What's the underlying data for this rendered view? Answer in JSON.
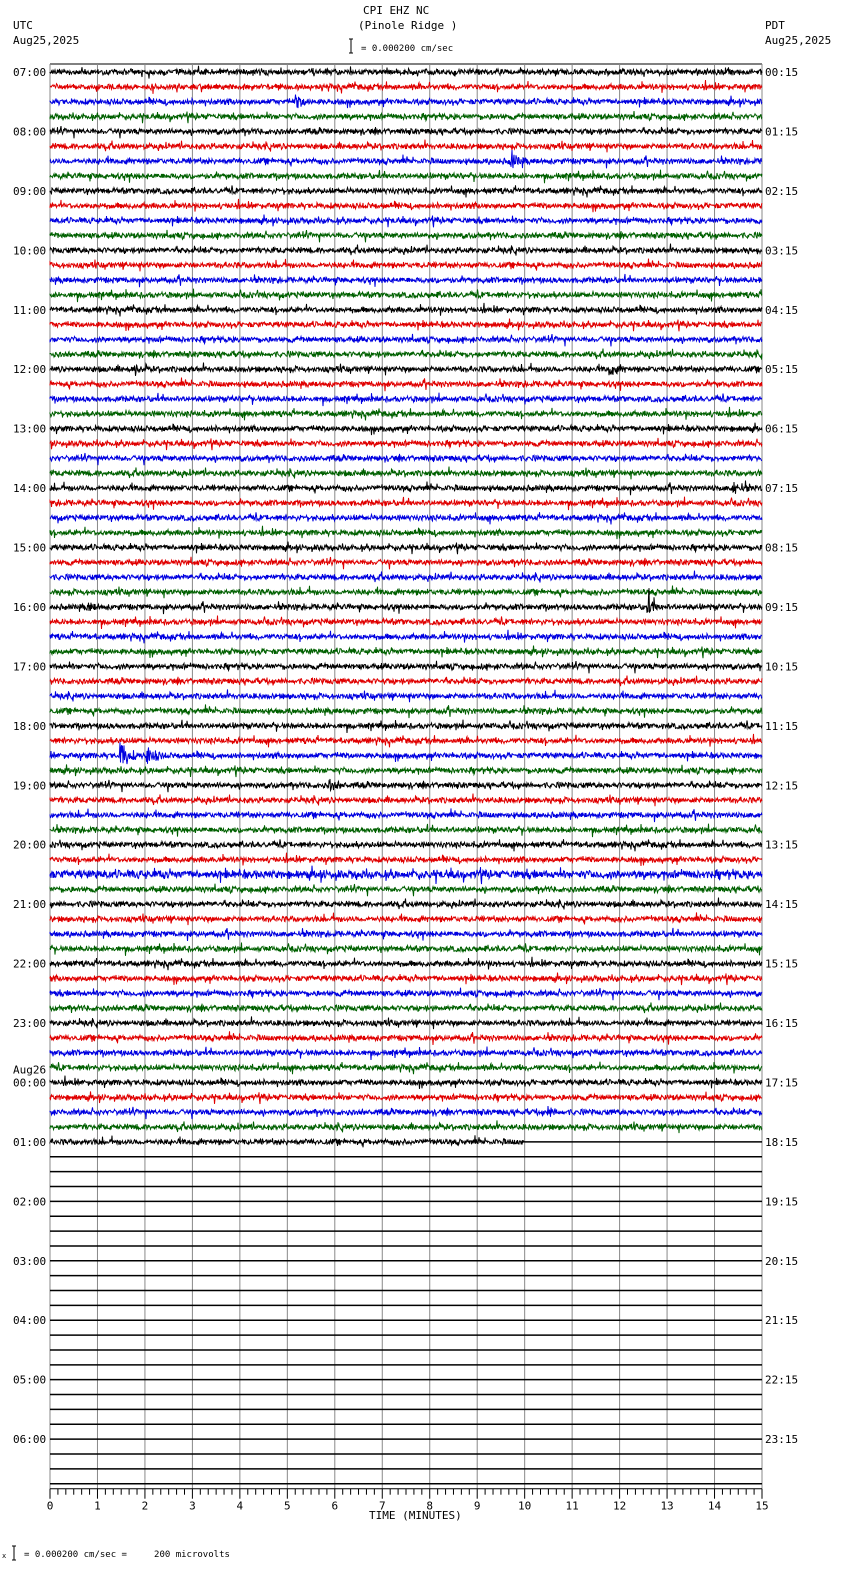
{
  "header": {
    "title": "CPI EHZ NC",
    "subtitle": "(Pinole Ridge )",
    "left_tz": "UTC",
    "left_date": "Aug25,2025",
    "right_tz": "PDT",
    "right_date": "Aug25,2025",
    "scale_text": "= 0.000200 cm/sec"
  },
  "footer": {
    "scale_text": "= 0.000200 cm/sec =     200 microvolts",
    "prefix": "x"
  },
  "chart_data": {
    "type": "line",
    "title": "CPI EHZ NC (Pinole Ridge )",
    "xlabel": "TIME (MINUTES)",
    "xlim": [
      0,
      15
    ],
    "x_ticks": [
      "0",
      "1",
      "2",
      "3",
      "4",
      "5",
      "6",
      "7",
      "8",
      "9",
      "10",
      "11",
      "12",
      "13",
      "14",
      "15"
    ],
    "rows_per_hour": 4,
    "row_minutes": 15,
    "trace_colors": [
      "#000000",
      "#e00000",
      "#0000e0",
      "#006000"
    ],
    "left_labels": [
      "07:00",
      "08:00",
      "09:00",
      "10:00",
      "11:00",
      "12:00",
      "13:00",
      "14:00",
      "15:00",
      "16:00",
      "17:00",
      "18:00",
      "19:00",
      "20:00",
      "21:00",
      "22:00",
      "23:00",
      "00:00",
      "01:00",
      "02:00",
      "03:00",
      "04:00",
      "05:00",
      "06:00"
    ],
    "date_change_label": {
      "hour_index": 17,
      "text": "Aug26"
    },
    "right_labels": [
      "00:15",
      "01:15",
      "02:15",
      "03:15",
      "04:15",
      "05:15",
      "06:15",
      "07:15",
      "08:15",
      "09:15",
      "10:15",
      "11:15",
      "12:15",
      "13:15",
      "14:15",
      "15:15",
      "16:15",
      "17:15",
      "18:15",
      "19:15",
      "20:15",
      "21:15",
      "22:15",
      "23:15"
    ],
    "total_rows": 96,
    "recorded_full_rows": 72,
    "last_row_end_minute": 10,
    "events": [
      {
        "row": 2,
        "minute": 5.2,
        "amp": 2
      },
      {
        "row": 6,
        "minute": 9.7,
        "amp": 3.5
      },
      {
        "row": 20,
        "minute": 11.8,
        "amp": 2
      },
      {
        "row": 20,
        "minute": 1.8,
        "amp": 1.6
      },
      {
        "row": 28,
        "minute": 14.4,
        "amp": 2.5
      },
      {
        "row": 36,
        "minute": 12.6,
        "amp": 2.5
      },
      {
        "row": 36,
        "minute": 0.8,
        "amp": 1.5
      },
      {
        "row": 46,
        "minute": 1.5,
        "amp": 6
      },
      {
        "row": 46,
        "minute": 2.05,
        "amp": 4
      },
      {
        "row": 48,
        "minute": 5.9,
        "amp": 1.6
      },
      {
        "row": 70,
        "minute": 10.5,
        "amp": 1.6
      }
    ]
  }
}
